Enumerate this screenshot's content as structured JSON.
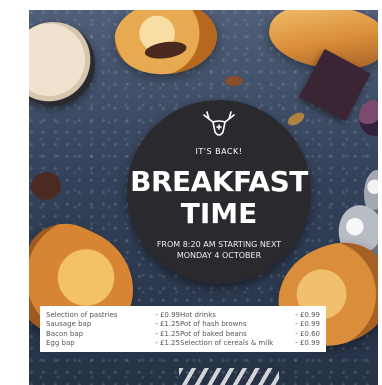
{
  "poster": {
    "tag": "IT'S BACK!",
    "headline_line1": "BREAKFAST",
    "headline_line2": "TIME",
    "subline_line1": "FROM 8:20 AM STARTING NEXT",
    "subline_line2": "MONDAY 4 OCTOBER",
    "logo_icon": "stag-head-icon"
  },
  "menu": {
    "left": [
      {
        "item": "Selection of pastries",
        "price": "- £0.99"
      },
      {
        "item": "Sausage bap",
        "price": "- £1.25"
      },
      {
        "item": "Bacon bap",
        "price": "- £1.25"
      },
      {
        "item": "Egg bap",
        "price": "- £1.25"
      }
    ],
    "right": [
      {
        "item": "Hot drinks",
        "price": "- £0.99"
      },
      {
        "item": "Pot of hash browns",
        "price": "- £0.99"
      },
      {
        "item": "Pot of baked beans",
        "price": "- £0.60"
      },
      {
        "item": "Selection of cereals & milk",
        "price": "- £0.99"
      }
    ]
  },
  "colors": {
    "background": "#33415a",
    "circle": "#2a2a2e",
    "text_light": "#ffffff",
    "menu_text": "#55565a"
  }
}
